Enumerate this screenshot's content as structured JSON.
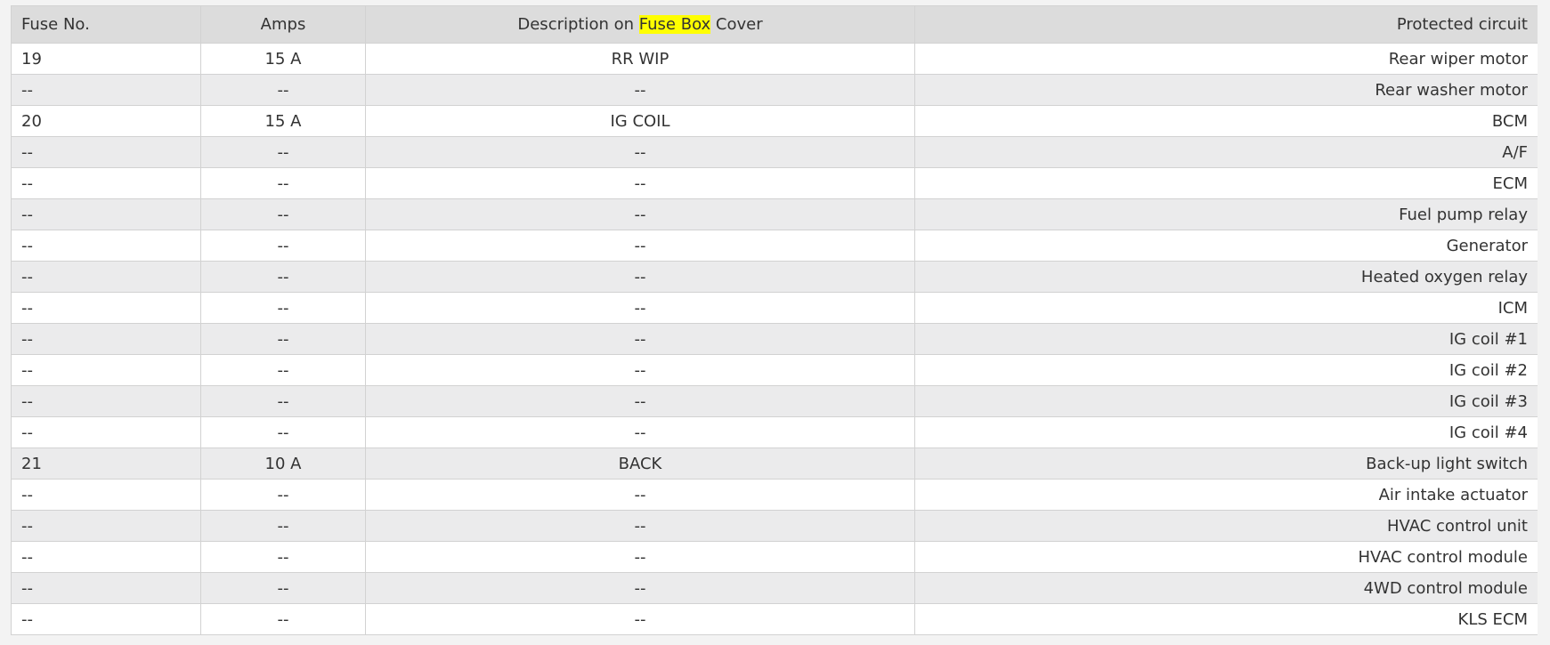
{
  "table": {
    "headers": {
      "fuse_no": "Fuse No.",
      "amps": "Amps",
      "description_before": "Description on ",
      "description_highlight": "Fuse Box",
      "description_after": " Cover",
      "protected_circuit": "Protected circuit"
    },
    "highlight_color": "#ffff00",
    "header_background": "#dcdcdc",
    "stripe_color": "#ebebec",
    "rows": [
      {
        "fuse_no": "19",
        "amps": "15 A",
        "description": "RR WIP",
        "circuit": "Rear wiper motor"
      },
      {
        "fuse_no": "--",
        "amps": "--",
        "description": "--",
        "circuit": "Rear washer motor"
      },
      {
        "fuse_no": "20",
        "amps": "15 A",
        "description": "IG COIL",
        "circuit": "BCM"
      },
      {
        "fuse_no": "--",
        "amps": "--",
        "description": "--",
        "circuit": "A/F"
      },
      {
        "fuse_no": "--",
        "amps": "--",
        "description": "--",
        "circuit": "ECM"
      },
      {
        "fuse_no": "--",
        "amps": "--",
        "description": "--",
        "circuit": "Fuel pump relay"
      },
      {
        "fuse_no": "--",
        "amps": "--",
        "description": "--",
        "circuit": "Generator"
      },
      {
        "fuse_no": "--",
        "amps": "--",
        "description": "--",
        "circuit": "Heated oxygen relay"
      },
      {
        "fuse_no": "--",
        "amps": "--",
        "description": "--",
        "circuit": "ICM"
      },
      {
        "fuse_no": "--",
        "amps": "--",
        "description": "--",
        "circuit": "IG coil #1"
      },
      {
        "fuse_no": "--",
        "amps": "--",
        "description": "--",
        "circuit": "IG coil #2"
      },
      {
        "fuse_no": "--",
        "amps": "--",
        "description": "--",
        "circuit": "IG coil #3"
      },
      {
        "fuse_no": "--",
        "amps": "--",
        "description": "--",
        "circuit": "IG coil #4"
      },
      {
        "fuse_no": "21",
        "amps": "10 A",
        "description": "BACK",
        "circuit": "Back-up light switch"
      },
      {
        "fuse_no": "--",
        "amps": "--",
        "description": "--",
        "circuit": "Air intake actuator"
      },
      {
        "fuse_no": "--",
        "amps": "--",
        "description": "--",
        "circuit": "HVAC control unit"
      },
      {
        "fuse_no": "--",
        "amps": "--",
        "description": "--",
        "circuit": "HVAC control module"
      },
      {
        "fuse_no": "--",
        "amps": "--",
        "description": "--",
        "circuit": "4WD control module"
      },
      {
        "fuse_no": "--",
        "amps": "--",
        "description": "--",
        "circuit": "KLS ECM"
      }
    ]
  }
}
